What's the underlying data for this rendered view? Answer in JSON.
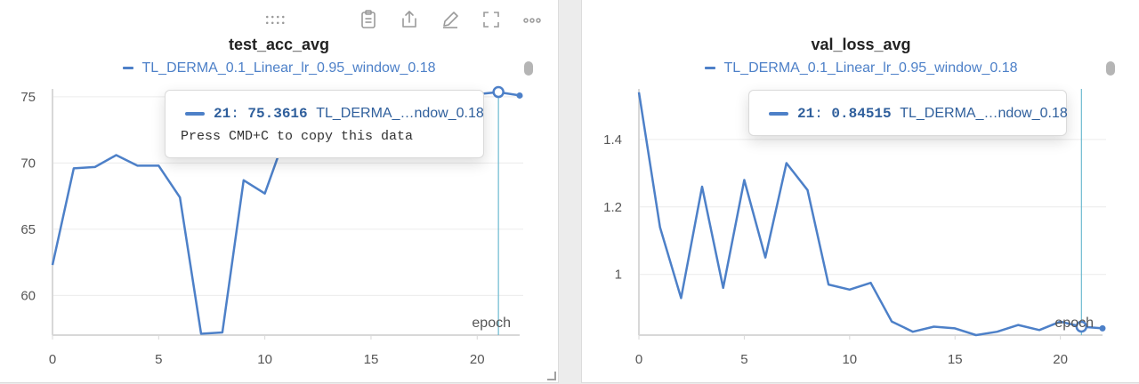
{
  "colors": {
    "series": "#4d80c8",
    "cursor": "#6cbad0",
    "grid": "#ececec",
    "axis": "#d8d8d8",
    "tick_text": "#555555"
  },
  "toolbar_icons": [
    "drag-handle-icon",
    "clipboard-icon",
    "share-icon",
    "edit-icon",
    "fullscreen-icon",
    "more-icon"
  ],
  "chart_data": [
    {
      "type": "line",
      "title": "test_acc_avg",
      "xlabel": "epoch",
      "ylabel": "",
      "xticks": [
        0,
        5,
        10,
        15,
        20
      ],
      "yticks": [
        60,
        65,
        70,
        75
      ],
      "xlim": [
        0,
        22
      ],
      "ylim": [
        57.0,
        75.6
      ],
      "grid": true,
      "legend_position": "top-center",
      "series": [
        {
          "name": "TL_DERMA_0.1_Linear_lr_0.95_window_0.18",
          "x": [
            0,
            1,
            2,
            3,
            4,
            5,
            6,
            7,
            8,
            9,
            10,
            11,
            12,
            13,
            14,
            15,
            16,
            17,
            18,
            19,
            20,
            21,
            22
          ],
          "y": [
            62.3,
            69.6,
            69.7,
            70.6,
            69.8,
            69.8,
            67.4,
            57.1,
            57.2,
            68.7,
            67.7,
            72.2,
            73.0,
            73.5,
            74.0,
            74.3,
            74.6,
            74.8,
            75.0,
            75.1,
            75.2,
            75.3616,
            75.1
          ]
        }
      ],
      "tooltip": {
        "step": "21",
        "value": "75.3616",
        "series_label": "TL_DERMA_…ndow_0.18",
        "hint": "Press CMD+C to copy this data"
      },
      "cursor_x": 21
    },
    {
      "type": "line",
      "title": "val_loss_avg",
      "xlabel": "epoch",
      "ylabel": "",
      "xticks": [
        0,
        5,
        10,
        15,
        20
      ],
      "yticks": [
        1,
        1.2,
        1.4
      ],
      "xlim": [
        0,
        22
      ],
      "ylim": [
        0.82,
        1.55
      ],
      "grid": true,
      "legend_position": "top-center",
      "series": [
        {
          "name": "TL_DERMA_0.1_Linear_lr_0.95_window_0.18",
          "x": [
            0,
            1,
            2,
            3,
            4,
            5,
            6,
            7,
            8,
            9,
            10,
            11,
            12,
            13,
            14,
            15,
            16,
            17,
            18,
            19,
            20,
            21,
            22
          ],
          "y": [
            1.54,
            1.14,
            0.93,
            1.26,
            0.96,
            1.28,
            1.05,
            1.33,
            1.25,
            0.97,
            0.955,
            0.975,
            0.86,
            0.83,
            0.845,
            0.84,
            0.82,
            0.83,
            0.85,
            0.835,
            0.86,
            0.84515,
            0.84
          ]
        }
      ],
      "tooltip": {
        "step": "21",
        "value": "0.84515",
        "series_label": "TL_DERMA_…ndow_0.18",
        "hint": ""
      },
      "cursor_x": 21
    }
  ]
}
